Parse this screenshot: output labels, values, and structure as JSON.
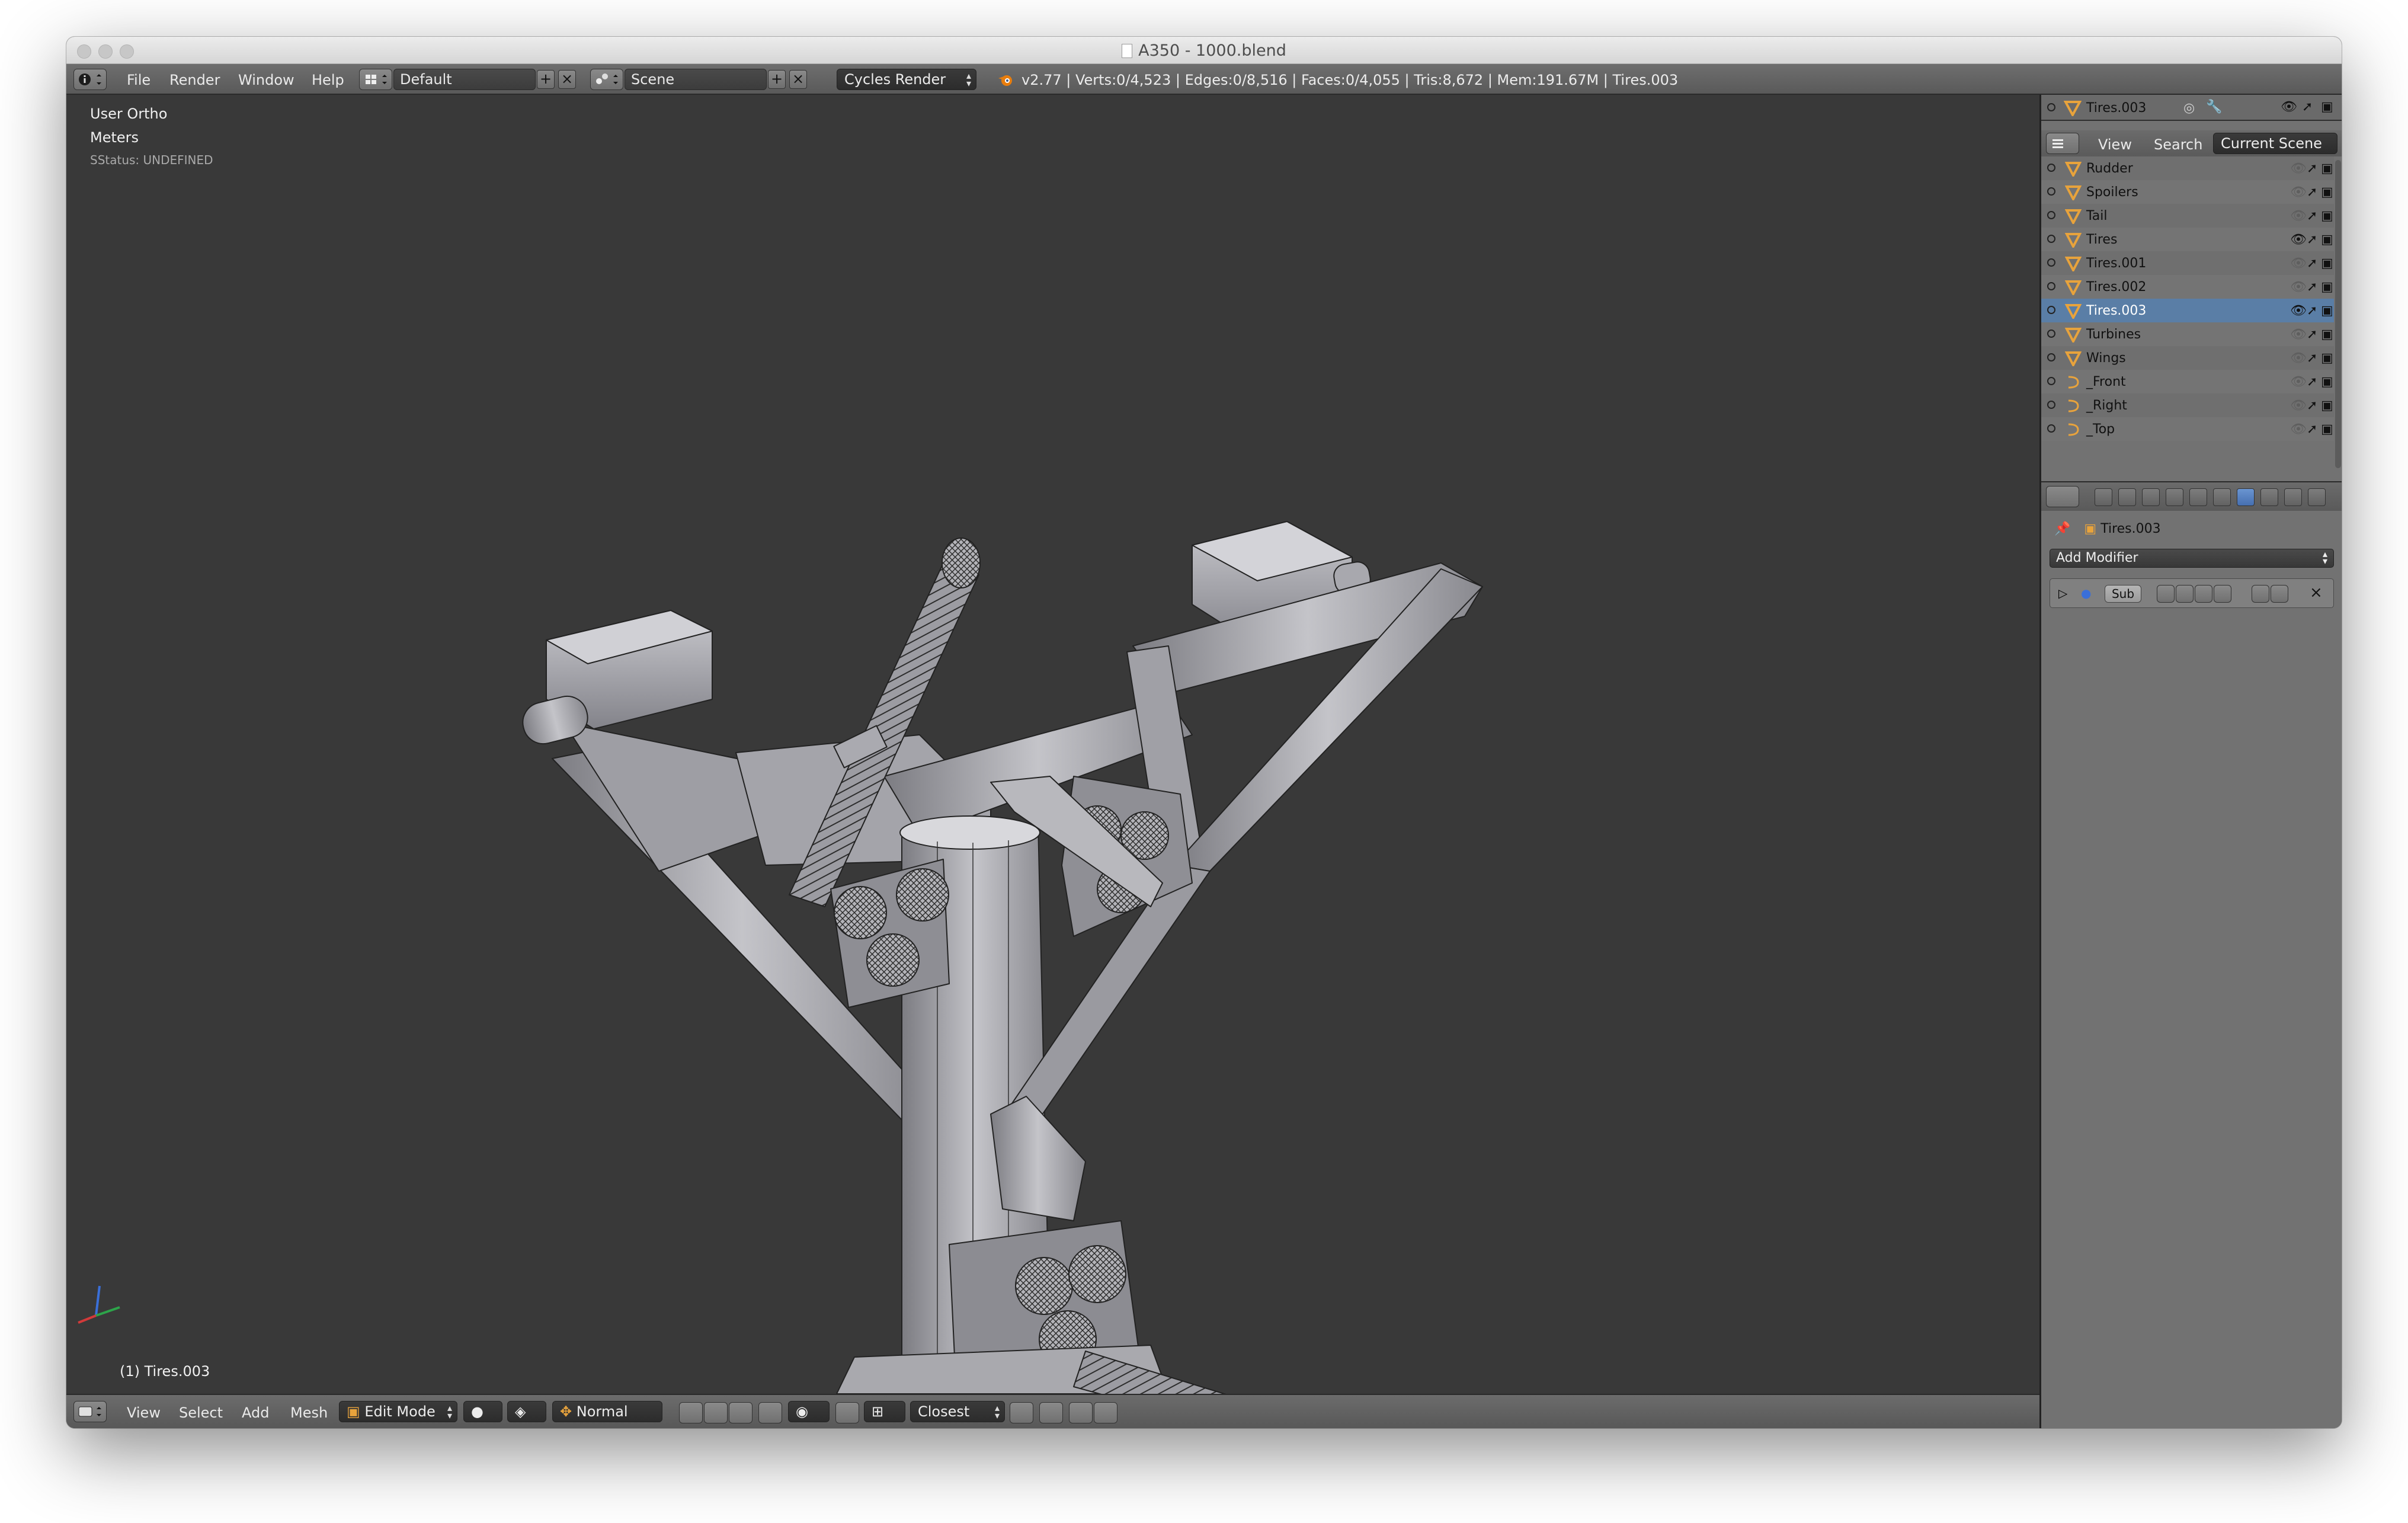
{
  "window": {
    "title": "A350 - 1000.blend"
  },
  "info_header": {
    "menus": [
      "File",
      "Render",
      "Window",
      "Help"
    ],
    "screen_layout": "Default",
    "scene": "Scene",
    "render_engine": "Cycles Render",
    "stats": "v2.77 | Verts:0/4,523 | Edges:0/8,516 | Faces:0/4,055 | Tris:8,672 | Mem:191.67M | Tires.003"
  },
  "viewport": {
    "view_name": "User Ortho",
    "units": "Meters",
    "status": "SStatus: UNDEFINED",
    "active_object": "(1) Tires.003"
  },
  "viewport_footer": {
    "menus": [
      "View",
      "Select",
      "Add",
      "Mesh"
    ],
    "mode": "Edit Mode",
    "orientation": "Normal",
    "snap_target": "Closest"
  },
  "outliner": {
    "active_object": "Tires.003",
    "tabs": [
      "View",
      "Search",
      "Current Scene"
    ],
    "items": [
      {
        "name": "Rudder",
        "type": "mesh",
        "visible": false
      },
      {
        "name": "Spoilers",
        "type": "mesh",
        "visible": false
      },
      {
        "name": "Tail",
        "type": "mesh",
        "visible": false
      },
      {
        "name": "Tires",
        "type": "mesh",
        "visible": true
      },
      {
        "name": "Tires.001",
        "type": "mesh",
        "visible": false
      },
      {
        "name": "Tires.002",
        "type": "mesh",
        "visible": false
      },
      {
        "name": "Tires.003",
        "type": "mesh",
        "visible": true,
        "selected": true
      },
      {
        "name": "Turbines",
        "type": "mesh",
        "visible": false
      },
      {
        "name": "Wings",
        "type": "mesh",
        "visible": false
      },
      {
        "name": "_Front",
        "type": "image",
        "visible": false
      },
      {
        "name": "_Right",
        "type": "image",
        "visible": false
      },
      {
        "name": "_Top",
        "type": "image",
        "visible": false
      }
    ]
  },
  "properties": {
    "context_object": "Tires.003",
    "add_modifier_label": "Add Modifier",
    "modifier_name": "Sub"
  },
  "colors": {
    "viewport_bg": "#393939",
    "header_bg": "#626262",
    "mesh_fill": "#a8a8ad",
    "selection_blue": "#5a7ea6",
    "object_orange": "#e8a33c"
  }
}
